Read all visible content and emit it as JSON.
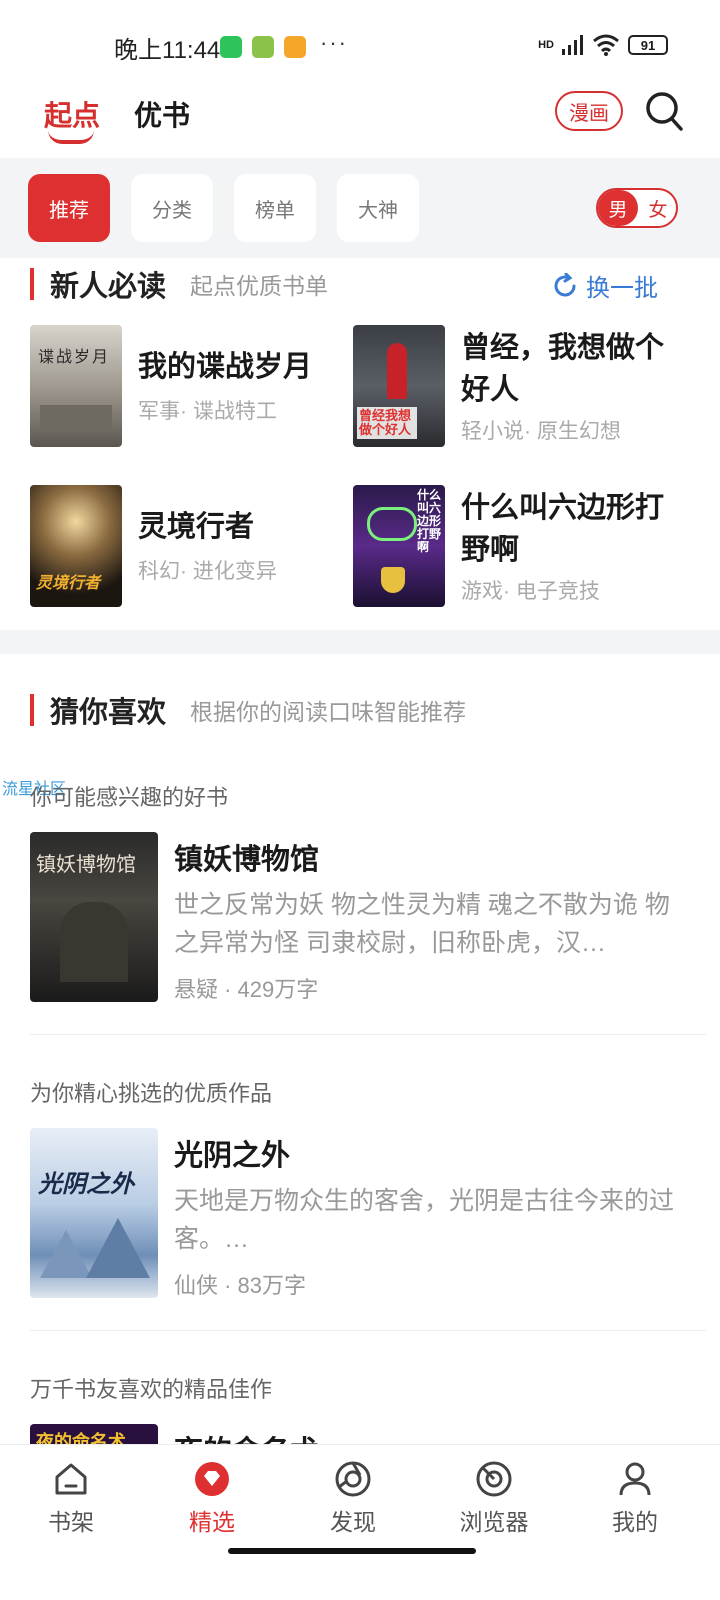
{
  "status_bar": {
    "time": "晚上11:44",
    "more": "···",
    "network": "HD",
    "battery": "91"
  },
  "header": {
    "tabs": [
      {
        "label": "起点",
        "active": true
      },
      {
        "label": "优书",
        "active": false
      }
    ],
    "comic_button": "漫画"
  },
  "channels": {
    "chips": [
      {
        "label": "推荐",
        "active": true
      },
      {
        "label": "分类",
        "active": false
      },
      {
        "label": "榜单",
        "active": false
      },
      {
        "label": "大神",
        "active": false
      }
    ],
    "gender": {
      "male": "男",
      "female": "女",
      "selected": "男"
    }
  },
  "must_read": {
    "title": "新人必读",
    "subtitle": "起点优质书单",
    "refresh": "换一批",
    "books": [
      {
        "title": "我的谍战岁月",
        "meta": "军事· 谍战特工",
        "cover_text": "谍战岁月"
      },
      {
        "title": "曾经，我想做个好人",
        "meta": "轻小说· 原生幻想",
        "cover_text": "曾经我想做个好人"
      },
      {
        "title": "灵境行者",
        "meta": "科幻· 进化变异",
        "cover_text": "灵境行者"
      },
      {
        "title": "什么叫六边形打野啊",
        "meta": "游戏· 电子竞技",
        "cover_text": "什么叫六边形打野啊"
      }
    ]
  },
  "guess_you_like": {
    "title": "猜你喜欢",
    "subtitle": "根据你的阅读口味智能推荐",
    "watermark": "流星社区",
    "items": [
      {
        "reason": "你可能感兴趣的好书",
        "title": "镇妖博物馆",
        "desc": "世之反常为妖 物之性灵为精 魂之不散为诡 物之异常为怪 司隶校尉，旧称卧虎，汉…",
        "meta": "悬疑 · 429万字",
        "cover_text": "镇妖博物馆"
      },
      {
        "reason": "为你精心挑选的优质作品",
        "title": "光阴之外",
        "desc": "天地是万物众生的客舍，光阴是古往今来的过客。…",
        "meta": "仙侠 · 83万字",
        "cover_text": "光阴之外"
      },
      {
        "reason": "万千书友喜欢的精品佳作",
        "title": "夜的命名术",
        "desc": "",
        "meta": "",
        "cover_text": "夜的命名术"
      }
    ]
  },
  "bottom_nav": [
    {
      "label": "书架",
      "icon": "home-icon",
      "active": false
    },
    {
      "label": "精选",
      "icon": "diamond-icon",
      "active": true
    },
    {
      "label": "发现",
      "icon": "compass-icon",
      "active": false
    },
    {
      "label": "浏览器",
      "icon": "browser-icon",
      "active": false
    },
    {
      "label": "我的",
      "icon": "person-icon",
      "active": false
    }
  ],
  "colors": {
    "accent": "#de3030",
    "link": "#3a7bd5",
    "muted": "#999999",
    "band": "#f3f4f6"
  }
}
